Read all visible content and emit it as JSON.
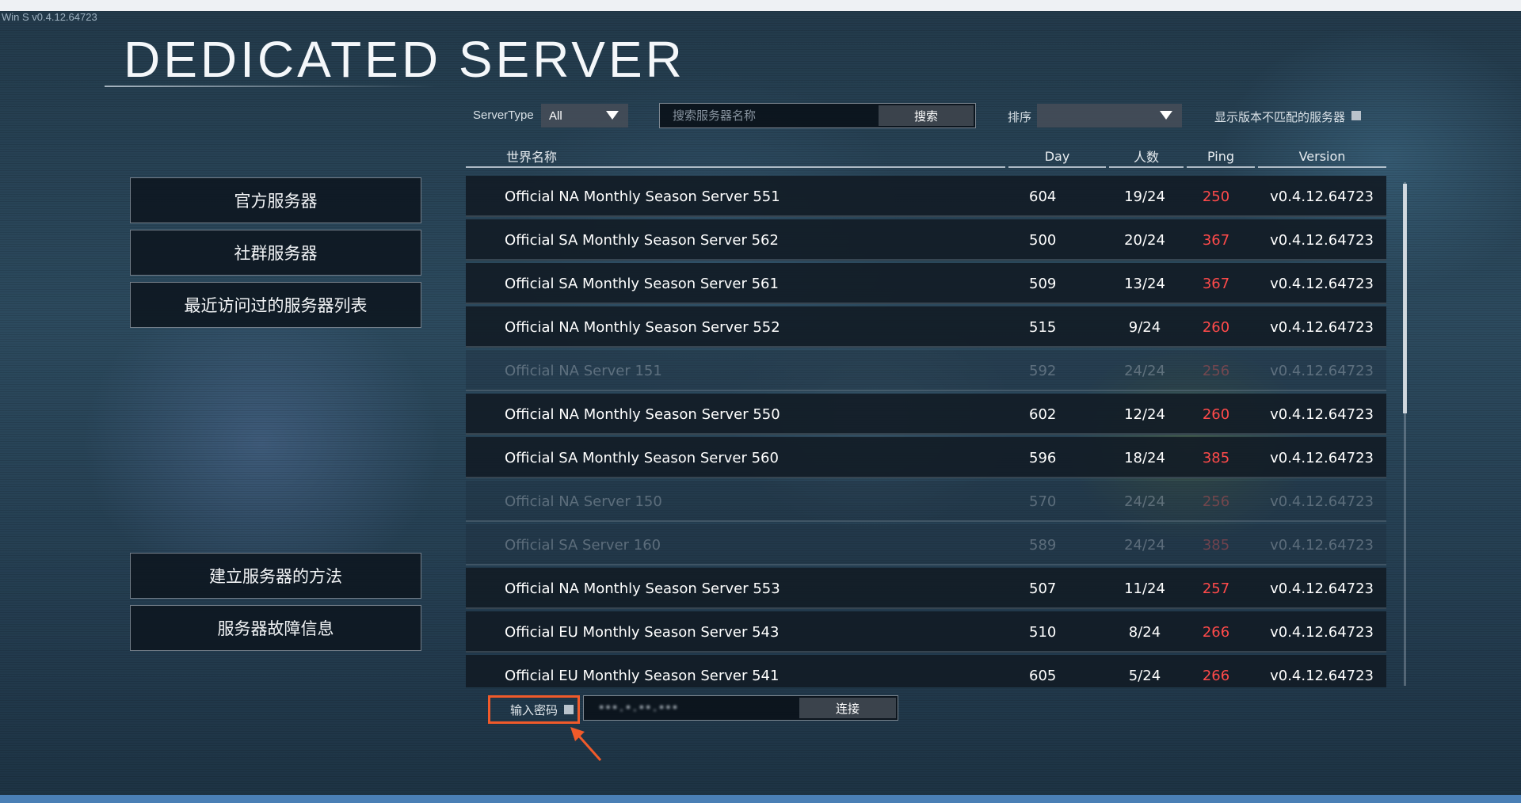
{
  "build_tag": "Win S v0.4.12.64723",
  "title": "DEDICATED SERVER",
  "menu": {
    "official": "官方服务器",
    "community": "社群服务器",
    "recent": "最近访问过的服务器列表",
    "howto": "建立服务器的方法",
    "troubleshoot": "服务器故障信息"
  },
  "filters": {
    "server_type_label": "ServerType",
    "server_type_value": "All",
    "search_placeholder": "搜索服务器名称",
    "search_button": "搜索",
    "sort_label": "排序",
    "sort_value": "",
    "mismatch_label": "显示版本不匹配的服务器"
  },
  "table": {
    "headers": {
      "name": "世界名称",
      "day": "Day",
      "players": "人数",
      "ping": "Ping",
      "version": "Version"
    },
    "rows": [
      {
        "name": "Official NA Monthly Season Server 551",
        "day": "604",
        "players": "19/24",
        "ping": "250",
        "version": "v0.4.12.64723",
        "dimmed": false
      },
      {
        "name": "Official SA Monthly Season Server 562",
        "day": "500",
        "players": "20/24",
        "ping": "367",
        "version": "v0.4.12.64723",
        "dimmed": false
      },
      {
        "name": "Official SA Monthly Season Server 561",
        "day": "509",
        "players": "13/24",
        "ping": "367",
        "version": "v0.4.12.64723",
        "dimmed": false
      },
      {
        "name": "Official NA Monthly Season Server 552",
        "day": "515",
        "players": "9/24",
        "ping": "260",
        "version": "v0.4.12.64723",
        "dimmed": false
      },
      {
        "name": "Official NA Server 151",
        "day": "592",
        "players": "24/24",
        "ping": "256",
        "version": "v0.4.12.64723",
        "dimmed": true
      },
      {
        "name": "Official NA Monthly Season Server 550",
        "day": "602",
        "players": "12/24",
        "ping": "260",
        "version": "v0.4.12.64723",
        "dimmed": false
      },
      {
        "name": "Official SA Monthly Season Server 560",
        "day": "596",
        "players": "18/24",
        "ping": "385",
        "version": "v0.4.12.64723",
        "dimmed": false
      },
      {
        "name": "Official NA Server 150",
        "day": "570",
        "players": "24/24",
        "ping": "256",
        "version": "v0.4.12.64723",
        "dimmed": true
      },
      {
        "name": "Official SA Server 160",
        "day": "589",
        "players": "24/24",
        "ping": "385",
        "version": "v0.4.12.64723",
        "dimmed": true
      },
      {
        "name": "Official NA Monthly Season Server 553",
        "day": "507",
        "players": "11/24",
        "ping": "257",
        "version": "v0.4.12.64723",
        "dimmed": false
      },
      {
        "name": "Official EU Monthly Season Server 543",
        "day": "510",
        "players": "8/24",
        "ping": "266",
        "version": "v0.4.12.64723",
        "dimmed": false
      },
      {
        "name": "Official EU Monthly Season Server 541",
        "day": "605",
        "players": "5/24",
        "ping": "266",
        "version": "v0.4.12.64723",
        "dimmed": false
      }
    ]
  },
  "connect": {
    "password_label": "输入密码",
    "address_value": "•••.•.••.•••",
    "connect_button": "连接"
  },
  "colors": {
    "ping": "#ff4a4a",
    "highlight_box": "#f05a2a",
    "row_bg": "#121c26"
  },
  "icons": [
    "dropdown-caret-icon",
    "checkbox-icon",
    "annotation-arrow-icon"
  ]
}
